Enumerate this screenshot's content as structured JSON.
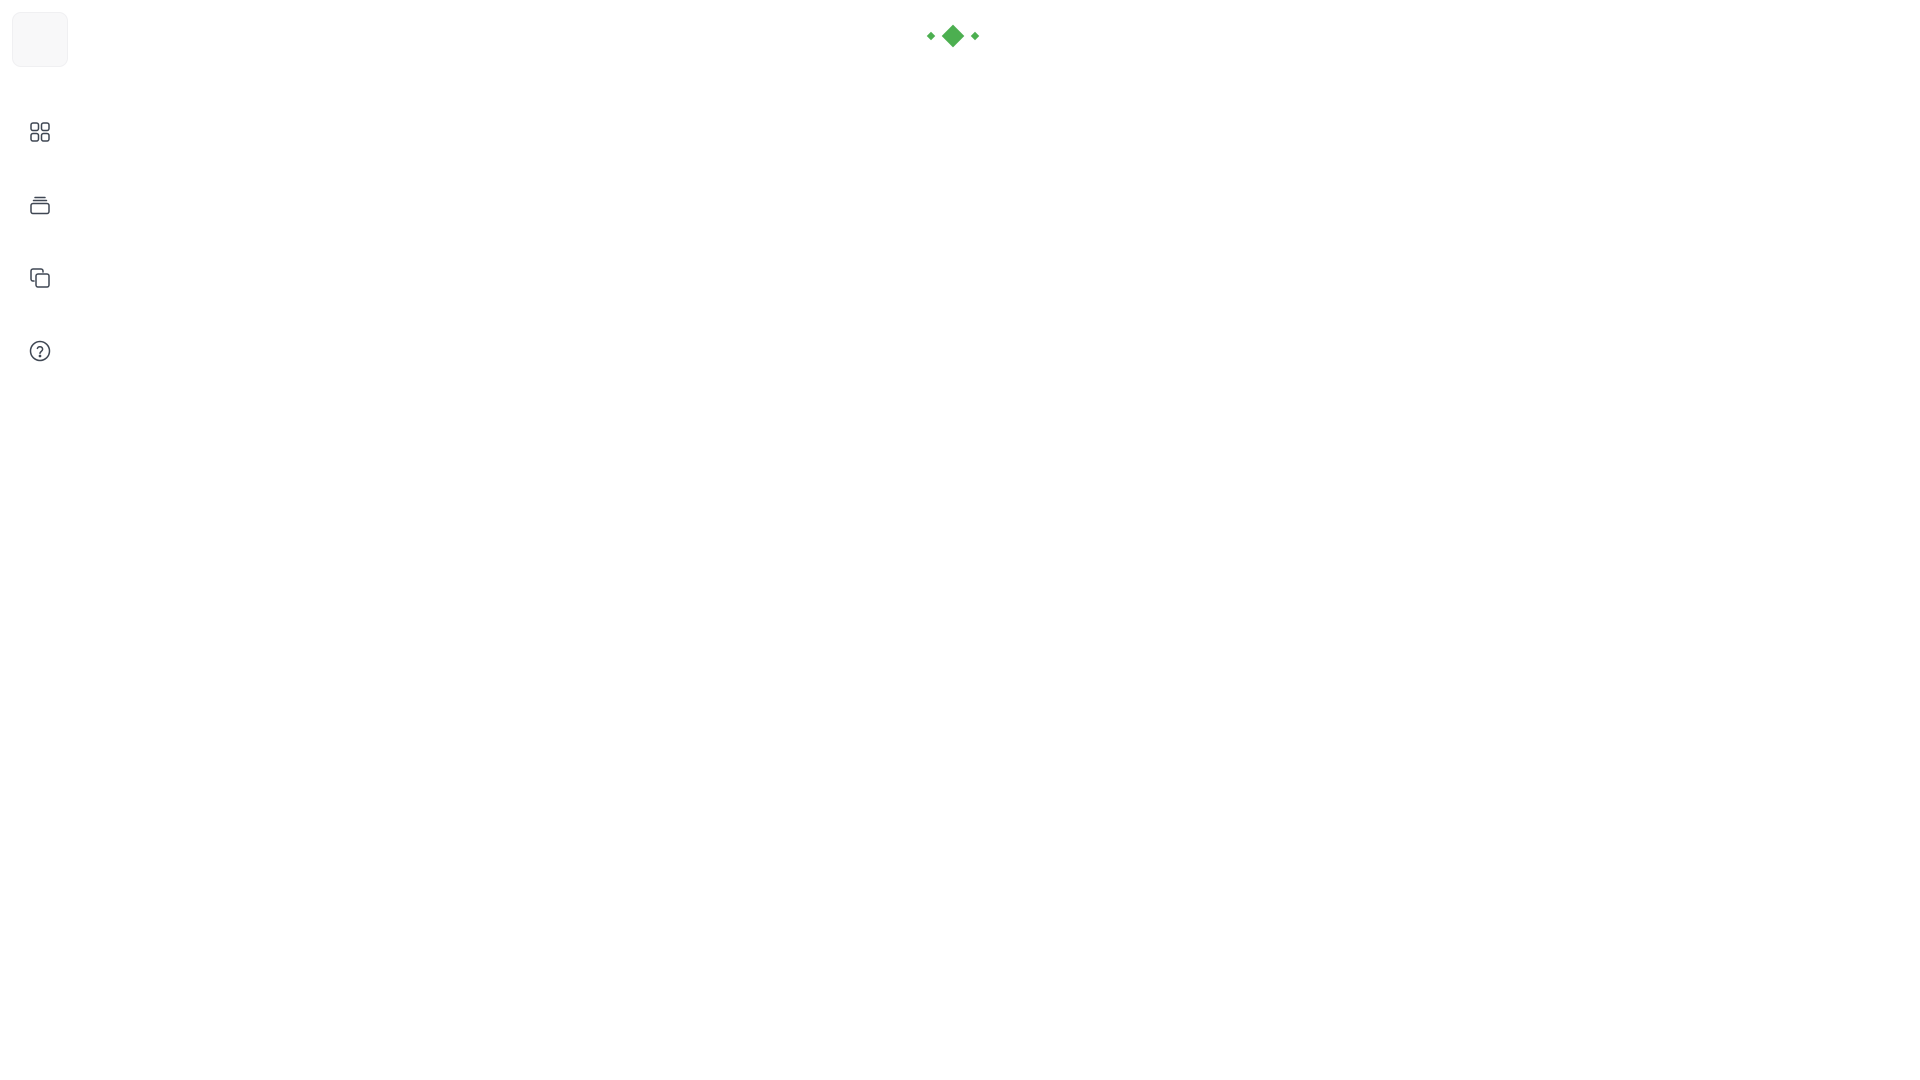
{
  "sidebar": {
    "toggle": {
      "icon": "menu-toggle"
    },
    "items": [
      {
        "id": "dashboard",
        "icon": "grid-icon"
      },
      {
        "id": "inventory",
        "icon": "archive-stack-icon"
      },
      {
        "id": "copies",
        "icon": "copy-icon"
      },
      {
        "id": "help",
        "icon": "help-circle-icon"
      }
    ]
  },
  "loader": {
    "icon": "diamond-loader-icon",
    "color": "#4caf50"
  },
  "colors": {
    "icon_stroke": "#3f4753",
    "toggle_bg": "#f8f8f9",
    "accent": "#4caf50"
  }
}
